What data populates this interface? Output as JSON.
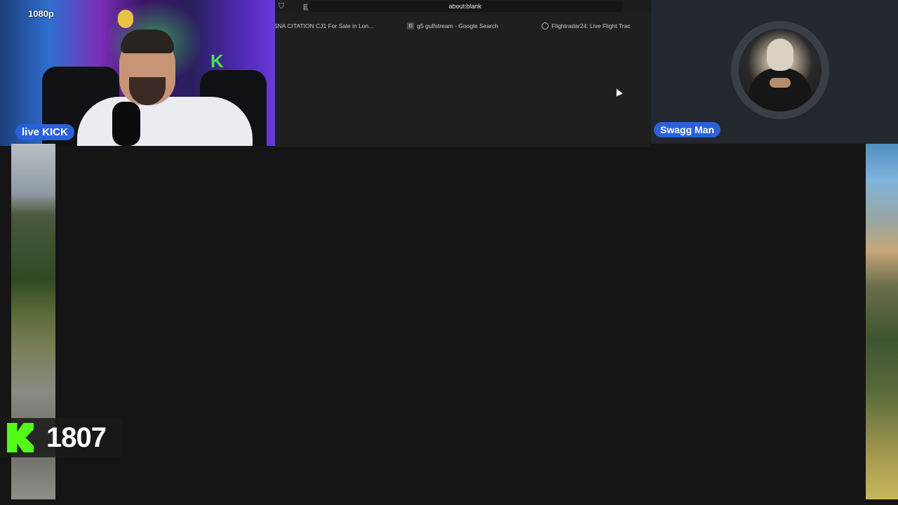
{
  "webcam": {
    "resolution": "1080p",
    "live_label": "live KICK"
  },
  "browser": {
    "url": "about:blank",
    "bookmarks": [
      {
        "label": "SNA CITATION CJ1 For Sale in Lon..."
      },
      {
        "label": "g5 gulfstream - Google Search"
      },
      {
        "label": "Flightradar24: Live Flight Trac"
      }
    ]
  },
  "guest": {
    "name": "Swagg Man"
  },
  "kick_counter": {
    "value": "1807"
  },
  "colors": {
    "badge_blue": "#2a61d8",
    "kick_green": "#53fc18",
    "background": "#151515"
  }
}
